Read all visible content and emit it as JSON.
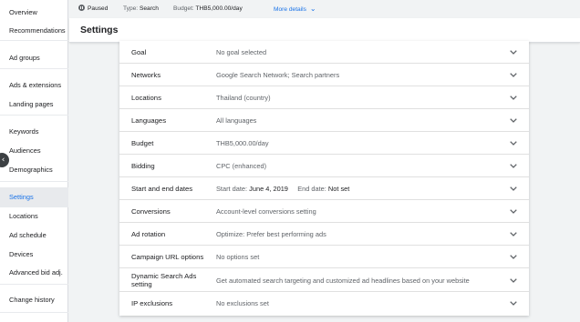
{
  "sidebar": {
    "items": [
      {
        "label": "Overview",
        "active": false
      },
      {
        "label": "Recommendations",
        "active": false
      },
      {
        "label": "Ad groups",
        "active": false
      },
      {
        "label": "Ads & extensions",
        "active": false
      },
      {
        "label": "Landing pages",
        "active": false
      },
      {
        "label": "Keywords",
        "active": false
      },
      {
        "label": "Audiences",
        "active": false
      },
      {
        "label": "Demographics",
        "active": false
      },
      {
        "label": "Settings",
        "active": true
      },
      {
        "label": "Locations",
        "active": false
      },
      {
        "label": "Ad schedule",
        "active": false
      },
      {
        "label": "Devices",
        "active": false
      },
      {
        "label": "Advanced bid adj.",
        "active": false
      },
      {
        "label": "Change history",
        "active": false
      }
    ],
    "collapse_icon": "chevron-left-icon"
  },
  "status": {
    "state": "Paused",
    "type_label": "Type:",
    "type_value": "Search",
    "budget_label": "Budget:",
    "budget_value": "THB5,000.00/day",
    "more_details": "More details"
  },
  "header": {
    "title": "Settings"
  },
  "settings": {
    "rows": [
      {
        "label": "Goal",
        "value": "No goal selected"
      },
      {
        "label": "Networks",
        "value": "Google Search Network; Search partners"
      },
      {
        "label": "Locations",
        "value": "Thailand (country)"
      },
      {
        "label": "Languages",
        "value": "All languages"
      },
      {
        "label": "Budget",
        "value": "THB5,000.00/day"
      },
      {
        "label": "Bidding",
        "value": "CPC (enhanced)"
      },
      {
        "label": "Start and end dates",
        "start_label": "Start date:",
        "start_value": "June 4, 2019",
        "end_label": "End date:",
        "end_value": "Not set"
      },
      {
        "label": "Conversions",
        "value": "Account-level conversions setting"
      },
      {
        "label": "Ad rotation",
        "value": "Optimize: Prefer best performing ads"
      },
      {
        "label": "Campaign URL options",
        "value": "No options set"
      },
      {
        "label": "Dynamic Search Ads setting",
        "value": "Get automated search targeting and customized ad headlines based on your website"
      },
      {
        "label": "IP exclusions",
        "value": "No exclusions set"
      }
    ]
  },
  "colors": {
    "accent": "#1a73e8",
    "background": "#f1f3f4",
    "text_primary": "#202124",
    "text_secondary": "#5f6368"
  }
}
